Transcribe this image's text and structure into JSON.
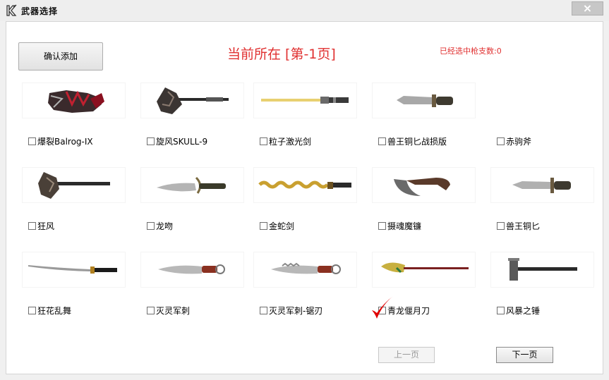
{
  "window": {
    "title": "武器选择",
    "close_label": "×"
  },
  "toolbar": {
    "confirm_label": "确认添加",
    "page_indicator": "当前所在 [第-1页]",
    "selected_count": "已经选中枪支数:0"
  },
  "items": [
    {
      "label": "爆裂Balrog-IX",
      "checked": false,
      "icon": "gauntlet-icon"
    },
    {
      "label": "旋风SKULL-9",
      "checked": false,
      "icon": "battle-axe-icon"
    },
    {
      "label": "粒子激光剑",
      "checked": false,
      "icon": "laser-sword-icon"
    },
    {
      "label": "兽王铜匕战损版",
      "checked": false,
      "icon": "dagger-icon"
    },
    {
      "label": "赤驹斧",
      "checked": false,
      "icon": "axe-icon"
    },
    {
      "label": "狂风",
      "checked": false,
      "icon": "axe-icon"
    },
    {
      "label": "龙吻",
      "checked": false,
      "icon": "dagger-icon"
    },
    {
      "label": "金蛇剑",
      "checked": false,
      "icon": "serpent-sword-icon"
    },
    {
      "label": "摄魂魔镰",
      "checked": false,
      "icon": "sickle-icon"
    },
    {
      "label": "兽王铜匕",
      "checked": false,
      "icon": "dagger-icon"
    },
    {
      "label": "狂花乱舞",
      "checked": false,
      "icon": "katana-icon"
    },
    {
      "label": "灭灵军刺",
      "checked": false,
      "icon": "knife-icon"
    },
    {
      "label": "灭灵军刺-锯刃",
      "checked": false,
      "icon": "knife-icon"
    },
    {
      "label": "青龙偃月刀",
      "checked": false,
      "icon": "glaive-icon"
    },
    {
      "label": "风暴之锤",
      "checked": false,
      "icon": "hammer-icon"
    }
  ],
  "pagination": {
    "prev_label": "上一页",
    "next_label": "下一页"
  },
  "colors": {
    "accent_red": "#e03030",
    "check_mark": "#e00000"
  }
}
